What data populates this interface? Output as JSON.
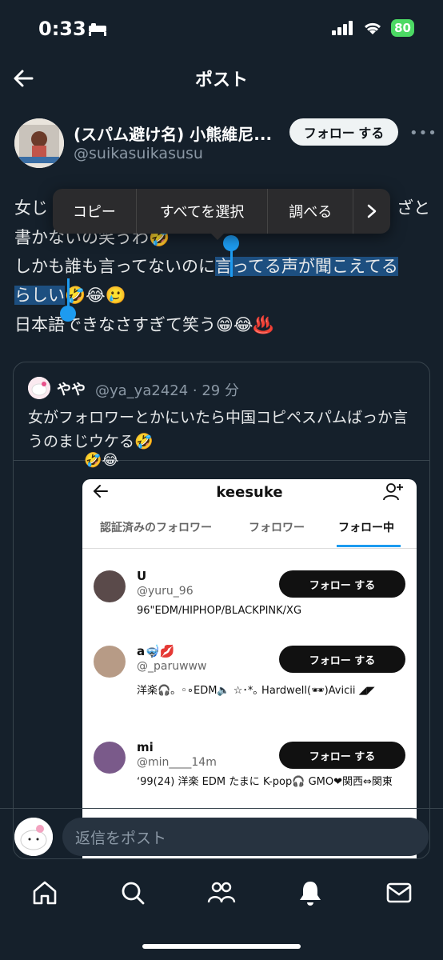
{
  "status_bar": {
    "time": "0:33",
    "battery": "80"
  },
  "header": {
    "title": "ポスト"
  },
  "author": {
    "name": "(スパム避け名) 小熊維尼...",
    "handle": "@suikasuikasusu",
    "follow_label": "フォロー する"
  },
  "post": {
    "line1_start": "女じ",
    "line1_end": "ざと",
    "line2": "書かないの笑うわ🤣",
    "line3_plain": "しかも誰も言ってないのに",
    "line3_sel": "言ってる声が聞こえてる",
    "line4_sel": "らしい",
    "line4_rest": "🤣😂🥲",
    "line5": "日本語できなさすぎて笑う😁😂♨️"
  },
  "context_menu": {
    "copy": "コピー",
    "select_all": "すべてを選択",
    "lookup": "調べる"
  },
  "quote": {
    "name": "やや",
    "handle_time": "@ya_ya2424 · 29 分",
    "text": "女がフォロワーとかにいたら中国コピペスパムばっか言うのまじウケる🤣",
    "emoji_peek": "🤣😂",
    "embedded": {
      "title": "keesuke",
      "tabs": [
        "認証済みのフォロワー",
        "フォロワー",
        "フォロー中"
      ],
      "users": [
        {
          "name": "U",
          "handle": "@yuru_96",
          "bio": "96\"EDM/HIPHOP/BLACKPINK/XG",
          "follow": "フォロー する"
        },
        {
          "name": "a🤿💋",
          "handle": "@_paruwww",
          "bio": "洋楽🎧。◦∘EDM🔈 ☆･*｡ Hardwell(🕶)Avicii ◢◤",
          "follow": "フォロー する"
        },
        {
          "name": "mi",
          "handle": "@min____14m",
          "bio": "ʻ99(24) 洋楽 EDM たまに K-pop🎧 GMO❤関西⇔関東",
          "follow": "フォロー する"
        }
      ]
    }
  },
  "reply": {
    "placeholder": "返信をポスト"
  }
}
